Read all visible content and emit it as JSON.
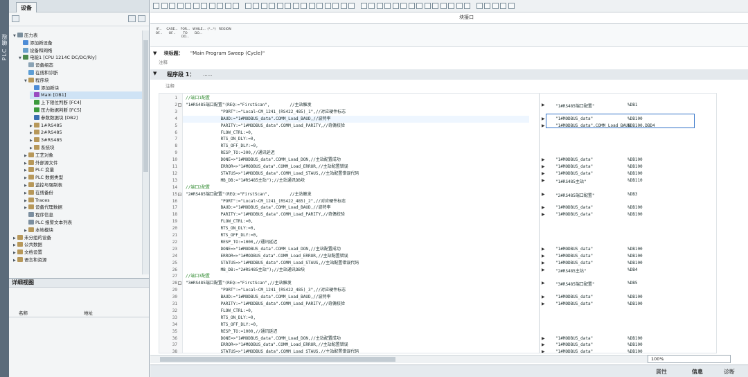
{
  "left_panel": {
    "side_tab_label": "PLC 编程",
    "tab_label": "设备",
    "tree": [
      {
        "label": "压力表",
        "indent": 0,
        "exp": "▼",
        "icon_color": "#7a8e9c"
      },
      {
        "label": "添加新设备",
        "indent": 1,
        "exp": "",
        "icon_color": "#4d8cd6"
      },
      {
        "label": "设备和网络",
        "indent": 1,
        "exp": "",
        "icon_color": "#6aa0c8"
      },
      {
        "label": "电能1 [CPU 1214C DC/DC/Rly]",
        "indent": 1,
        "exp": "▼",
        "icon_color": "#4c8a4c"
      },
      {
        "label": "设备组态",
        "indent": 2,
        "exp": "",
        "icon_color": "#8aa3b5"
      },
      {
        "label": "在线和诊断",
        "indent": 2,
        "exp": "",
        "icon_color": "#5d9ed5"
      },
      {
        "label": "程序块",
        "indent": 2,
        "exp": "▼",
        "icon_color": "#b7985a"
      },
      {
        "label": "添加新块",
        "indent": 3,
        "exp": "",
        "icon_color": "#4d8cd6"
      },
      {
        "label": "Main [OB1]",
        "indent": 3,
        "exp": "",
        "icon_color": "#9a4ac0"
      },
      {
        "label": "上下限位判断 [FC4]",
        "indent": 3,
        "exp": "",
        "icon_color": "#3c9a3c"
      },
      {
        "label": "压力数据判断 [FC5]",
        "indent": 3,
        "exp": "",
        "icon_color": "#3c9a3c"
      },
      {
        "label": "参数数据块 [DB2]",
        "indent": 3,
        "exp": "",
        "icon_color": "#3b6fb0"
      },
      {
        "label": "1#RS485",
        "indent": 3,
        "exp": "▶",
        "icon_color": "#b7985a"
      },
      {
        "label": "2#RS485",
        "indent": 3,
        "exp": "▶",
        "icon_color": "#b7985a"
      },
      {
        "label": "3#RS485",
        "indent": 3,
        "exp": "▶",
        "icon_color": "#b7985a"
      },
      {
        "label": "系统块",
        "indent": 3,
        "exp": "▶",
        "icon_color": "#b7985a"
      },
      {
        "label": "工艺对象",
        "indent": 2,
        "exp": "▶",
        "icon_color": "#b7985a"
      },
      {
        "label": "外部源文件",
        "indent": 2,
        "exp": "▶",
        "icon_color": "#b7985a"
      },
      {
        "label": "PLC 变量",
        "indent": 2,
        "exp": "▶",
        "icon_color": "#b7985a"
      },
      {
        "label": "PLC 数据类型",
        "indent": 2,
        "exp": "▶",
        "icon_color": "#b7985a"
      },
      {
        "label": "监控与强制表",
        "indent": 2,
        "exp": "▶",
        "icon_color": "#b7985a"
      },
      {
        "label": "在线备份",
        "indent": 2,
        "exp": "▶",
        "icon_color": "#b7985a"
      },
      {
        "label": "Traces",
        "indent": 2,
        "exp": "▶",
        "icon_color": "#b7985a"
      },
      {
        "label": "设备代理数据",
        "indent": 2,
        "exp": "▶",
        "icon_color": "#b7985a"
      },
      {
        "label": "程序信息",
        "indent": 2,
        "exp": "",
        "icon_color": "#7c8fa0"
      },
      {
        "label": "PLC 报警文本列表",
        "indent": 2,
        "exp": "",
        "icon_color": "#7c8fa0"
      },
      {
        "label": "本地模块",
        "indent": 2,
        "exp": "▶",
        "icon_color": "#b7985a"
      },
      {
        "label": "未分组的设备",
        "indent": 0,
        "exp": "▶",
        "icon_color": "#b7985a"
      },
      {
        "label": "公共数据",
        "indent": 0,
        "exp": "▶",
        "icon_color": "#b7985a"
      },
      {
        "label": "文档设置",
        "indent": 0,
        "exp": "▶",
        "icon_color": "#b7985a"
      },
      {
        "label": "语言和资源",
        "indent": 0,
        "exp": "▶",
        "icon_color": "#b7985a"
      }
    ],
    "selected_index": 8,
    "detail_view_title": "详细视图",
    "detail_columns": [
      "名称",
      "地址"
    ]
  },
  "editor": {
    "tab_label": "块接口",
    "instructions": [
      "IF... OF...",
      "CASE... OF...",
      "FOR... TO DO...",
      "WHILE... DO...",
      "(*...*)",
      "REGION"
    ],
    "block_title_label": "块标题：",
    "block_title_value": "\"Main Program Sweep (Cycle)\"",
    "block_comment": "注释",
    "network_title": "程序段 1：",
    "network_title_suffix": "......",
    "network_comment": "注释",
    "code_lines": [
      {
        "n": "1",
        "t": "//端口1配置",
        "c": true,
        "fold": false
      },
      {
        "n": "2",
        "t": "\"1#RS485端口配置\"(REQ:=\"FirstScan\",        //主站触发",
        "c": false,
        "fold": true
      },
      {
        "n": "3",
        "t": "              \"PORT\":=\"Local~CM_1241_(RS422_485)_1\",//对应硬件标志",
        "c": false,
        "fold": false
      },
      {
        "n": "4",
        "t": "              BAUD:=\"1#MODBUS_data\".COMM_Load_BAUD,//波特率",
        "c": false,
        "fold": false
      },
      {
        "n": "5",
        "t": "              PARITY:=\"1#MODBUS_data\".COMM_Load_PARITY,//奇偶校验",
        "c": false,
        "fold": false
      },
      {
        "n": "6",
        "t": "              FLOW_CTRL:=0,",
        "c": false,
        "fold": false
      },
      {
        "n": "7",
        "t": "              RTS_ON_DLY:=0,",
        "c": false,
        "fold": false
      },
      {
        "n": "8",
        "t": "              RTS_OFF_DLY:=0,",
        "c": false,
        "fold": false
      },
      {
        "n": "9",
        "t": "              RESP_TO:=300,//通讯延迟",
        "c": false,
        "fold": false
      },
      {
        "n": "10",
        "t": "              DONE=>\"1#MODBUS_data\".COMM_Load_DON,//主站配置成功",
        "c": false,
        "fold": false
      },
      {
        "n": "11",
        "t": "              ERROR=>\"1#MODBUS_data\".COMM_Load_ERROR,//主站配置错误",
        "c": false,
        "fold": false
      },
      {
        "n": "12",
        "t": "              STATUS=>\"1#MODBUS_data\".COMM_Load_STAUS,//主站配置错误代码",
        "c": false,
        "fold": false
      },
      {
        "n": "13",
        "t": "              MB_DB:=\"1#RS485主站\");//主站通讯DB块",
        "c": false,
        "fold": false
      },
      {
        "n": "14",
        "t": "//端口2配置",
        "c": true,
        "fold": false
      },
      {
        "n": "15",
        "t": "\"2#RS485端口配置\"(REQ:=\"FirstScan\",        //主站触发",
        "c": false,
        "fold": true
      },
      {
        "n": "16",
        "t": "              \"PORT\":=\"Local~CM_1241_(RS422_485)_2\",//对应硬件标志",
        "c": false,
        "fold": false
      },
      {
        "n": "17",
        "t": "              BAUD:=\"1#MODBUS_data\".COMM_Load_BAUD,//波特率",
        "c": false,
        "fold": false
      },
      {
        "n": "18",
        "t": "              PARITY:=\"1#MODBUS_data\".COMM_Load_PARITY,//奇偶校验",
        "c": false,
        "fold": false
      },
      {
        "n": "19",
        "t": "              FLOW_CTRL:=0,",
        "c": false,
        "fold": false
      },
      {
        "n": "20",
        "t": "              RTS_ON_DLY:=0,",
        "c": false,
        "fold": false
      },
      {
        "n": "21",
        "t": "              RTS_OFF_DLY:=0,",
        "c": false,
        "fold": false
      },
      {
        "n": "22",
        "t": "              RESP_TO:=1000,//通讯延迟",
        "c": false,
        "fold": false
      },
      {
        "n": "23",
        "t": "              DONE=>\"1#MODBUS_data\".COMM_Load_DON,//主站配置成功",
        "c": false,
        "fold": false
      },
      {
        "n": "24",
        "t": "              ERROR=>\"1#MODBUS_data\".COMM_Load_ERROR,//主站配置错误",
        "c": false,
        "fold": false
      },
      {
        "n": "25",
        "t": "              STATUS=>\"1#MODBUS_data\".COMM_Load_STAUS,//主站配置错误代码",
        "c": false,
        "fold": false
      },
      {
        "n": "26",
        "t": "              MB_DB:=\"2#RS485主站\");//主站通讯DB块",
        "c": false,
        "fold": false
      },
      {
        "n": "27",
        "t": "//端口3配置",
        "c": true,
        "fold": false
      },
      {
        "n": "28",
        "t": "\"3#RS485端口配置\"(REQ:=\"FirstScan\",//主站触发",
        "c": false,
        "fold": true
      },
      {
        "n": "29",
        "t": "              \"PORT\":=\"Local~CM_1241_(RS422_485)_3\",//对应硬件标志",
        "c": false,
        "fold": false
      },
      {
        "n": "30",
        "t": "              BAUD:=\"1#MODBUS_data\".COMM_Load_BAUD,//波特率",
        "c": false,
        "fold": false
      },
      {
        "n": "31",
        "t": "              PARITY:=\"1#MODBUS_data\".COMM_Load_PARITY,//奇偶校验",
        "c": false,
        "fold": false
      },
      {
        "n": "32",
        "t": "              FLOW_CTRL:=0,",
        "c": false,
        "fold": false
      },
      {
        "n": "33",
        "t": "              RTS_ON_DLY:=0,",
        "c": false,
        "fold": false
      },
      {
        "n": "34",
        "t": "              RTS_OFF_DLY:=0,",
        "c": false,
        "fold": false
      },
      {
        "n": "35",
        "t": "              RESP_TO:=1000,//通讯延迟",
        "c": false,
        "fold": false
      },
      {
        "n": "36",
        "t": "              DONE=>\"1#MODBUS_data\".COMM_Load_DON,//主站配置成功",
        "c": false,
        "fold": false
      },
      {
        "n": "37",
        "t": "              ERROR=>\"1#MODBUS_data\".COMM_Load_ERROR,//主站配置错误",
        "c": false,
        "fold": false
      },
      {
        "n": "38",
        "t": "              STATUS=>\"1#MODBUS_data\".COMM_Load_STAUS,//主站配置错误代码",
        "c": false,
        "fold": false
      }
    ],
    "watch": [
      {
        "line": 2,
        "v": "\"1#RS485端口配置\"",
        "r": "%DB1"
      },
      {
        "line": 4,
        "v": "\"1#MODBUS_data\"",
        "r": "%DB100"
      },
      {
        "line": 5,
        "v": "\"1#MODBUS_data\".COMM_Load_BAUD",
        "r": "%DB100.DBD4"
      },
      {
        "line": 10,
        "v": "\"1#MODBUS_data\"",
        "r": "%DB100"
      },
      {
        "line": 11,
        "v": "\"1#MODBUS_data\"",
        "r": "%DB100"
      },
      {
        "line": 12,
        "v": "\"1#MODBUS_data\"",
        "r": "%DB100"
      },
      {
        "line": 13,
        "v": "\"1#RS485主站\"",
        "r": "%DB110"
      },
      {
        "line": 15,
        "v": "\"2#RS485端口配置\"",
        "r": "%DB3"
      },
      {
        "line": 17,
        "v": "\"1#MODBUS_data\"",
        "r": "%DB100"
      },
      {
        "line": 18,
        "v": "\"1#MODBUS_data\"",
        "r": "%DB100"
      },
      {
        "line": 23,
        "v": "\"1#MODBUS_data\"",
        "r": "%DB100"
      },
      {
        "line": 24,
        "v": "\"1#MODBUS_data\"",
        "r": "%DB100"
      },
      {
        "line": 25,
        "v": "\"1#MODBUS_data\"",
        "r": "%DB100"
      },
      {
        "line": 26,
        "v": "\"2#RS485主站\"",
        "r": "%DB4"
      },
      {
        "line": 28,
        "v": "\"3#RS485端口配置\"",
        "r": "%DB5"
      },
      {
        "line": 30,
        "v": "\"1#MODBUS_data\"",
        "r": "%DB100"
      },
      {
        "line": 31,
        "v": "\"1#MODBUS_data\"",
        "r": "%DB100"
      },
      {
        "line": 36,
        "v": "\"1#MODBUS_data\"",
        "r": "%DB100"
      },
      {
        "line": 37,
        "v": "\"1#MODBUS_data\"",
        "r": "%DB100"
      },
      {
        "line": 38,
        "v": "\"1#MODBUS_data\"",
        "r": "%DB100"
      }
    ],
    "zoom_value": "100%"
  },
  "statusbar": {
    "properties": "属性",
    "info": "信息",
    "diagnostics": "诊断"
  }
}
